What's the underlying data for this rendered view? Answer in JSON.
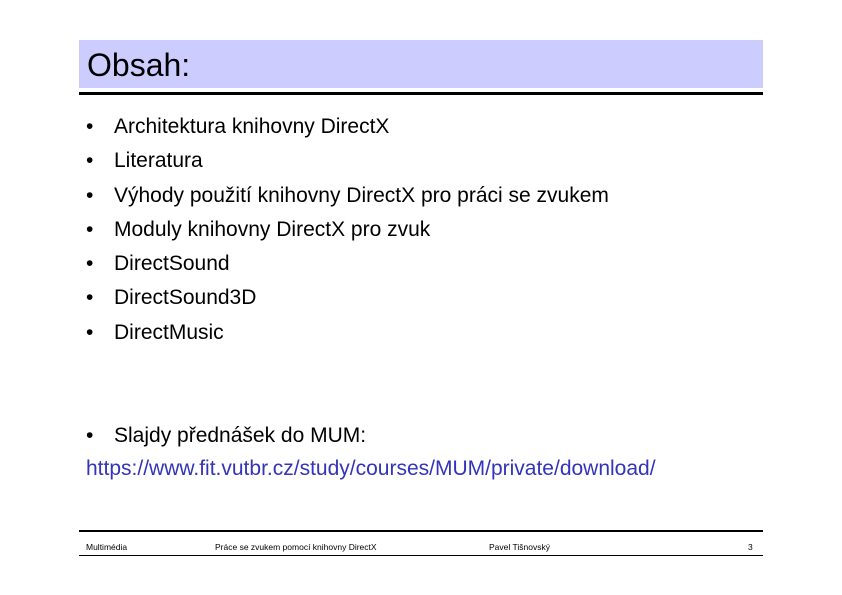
{
  "slide": {
    "title": "Obsah:",
    "bullet_symbol": "•",
    "items": [
      {
        "label": "Architektura knihovny DirectX"
      },
      {
        "label": "Literatura"
      },
      {
        "label": "Výhody použití knihovny DirectX pro práci se zvukem"
      },
      {
        "label": "Moduly knihovny DirectX pro zvuk"
      },
      {
        "label": "DirectSound"
      },
      {
        "label": "DirectSound3D"
      },
      {
        "label": "DirectMusic"
      }
    ],
    "slides_note": "Slajdy přednášek do MUM:",
    "slides_url": "https://www.fit.vutbr.cz/study/courses/MUM/private/download/"
  },
  "footer": {
    "course": "Multimédia",
    "topic": "Práce se zvukem pomocí knihovny DirectX",
    "author": "Pavel Tišnovský",
    "page_number": "3"
  },
  "colors": {
    "title_background": "#ccccff",
    "link": "#3333bb"
  }
}
